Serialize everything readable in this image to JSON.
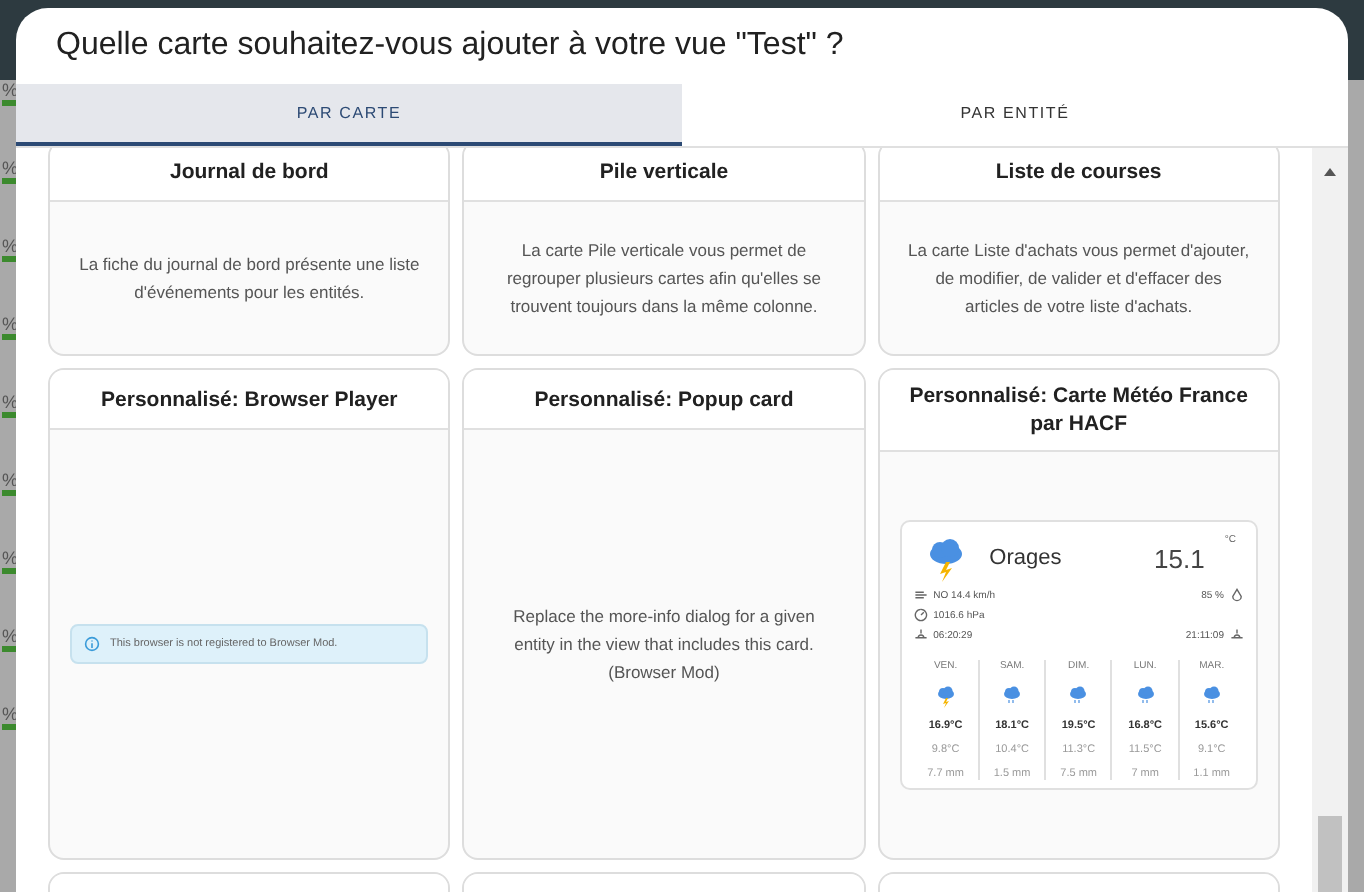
{
  "backdrop_marks": [
    "%",
    "%",
    "%",
    "%",
    "%",
    "%",
    "%",
    "%",
    "%"
  ],
  "dialog": {
    "title": "Quelle carte souhaitez-vous ajouter à votre vue \"Test\" ?"
  },
  "tabs": [
    {
      "label": "PAR CARTE",
      "selected": true
    },
    {
      "label": "PAR ENTITÉ",
      "selected": false
    }
  ],
  "cards": [
    {
      "kind": "text",
      "title": "Journal de bord",
      "description": "La fiche du journal de bord présente une liste d'événements pour les entités."
    },
    {
      "kind": "text",
      "title": "Pile verticale",
      "description": "La carte Pile verticale vous permet de regrouper plusieurs cartes afin qu'elles se trouvent toujours dans la même colonne."
    },
    {
      "kind": "text",
      "title": "Liste de courses",
      "description": "La carte Liste d'achats vous permet d'ajouter, de modifier, de valider et d'effacer des articles de votre liste d'achats."
    },
    {
      "kind": "alert",
      "title": "Personnalisé: Browser Player",
      "alert": "This browser is not registered to Browser Mod."
    },
    {
      "kind": "text",
      "title": "Personnalisé: Popup card",
      "description": "Replace the more-info dialog for a given entity in the view that includes this card. (Browser Mod)"
    },
    {
      "kind": "weather",
      "title": "Personnalisé: Carte Météo France par HACF",
      "weather": {
        "condition": "Orages",
        "temperature": "15.1",
        "unit": "°C",
        "wind": "NO 14.4 km/h",
        "humidity": "85 %",
        "pressure": "1016.6 hPa",
        "sunrise": "06:20:29",
        "sunset": "21:11:09",
        "forecast": [
          {
            "day": "VEN.",
            "kind": "storm",
            "high": "16.9°C",
            "low": "9.8°C",
            "rain": "7.7 mm"
          },
          {
            "day": "SAM.",
            "kind": "rain",
            "high": "18.1°C",
            "low": "10.4°C",
            "rain": "1.5 mm"
          },
          {
            "day": "DIM.",
            "kind": "rain",
            "high": "19.5°C",
            "low": "11.3°C",
            "rain": "7.5 mm"
          },
          {
            "day": "LUN.",
            "kind": "rain",
            "high": "16.8°C",
            "low": "11.5°C",
            "rain": "7 mm"
          },
          {
            "day": "MAR.",
            "kind": "rain",
            "high": "15.6°C",
            "low": "9.1°C",
            "rain": "1.1 mm"
          }
        ]
      }
    },
    {
      "kind": "empty"
    },
    {
      "kind": "empty"
    },
    {
      "kind": "empty"
    }
  ]
}
